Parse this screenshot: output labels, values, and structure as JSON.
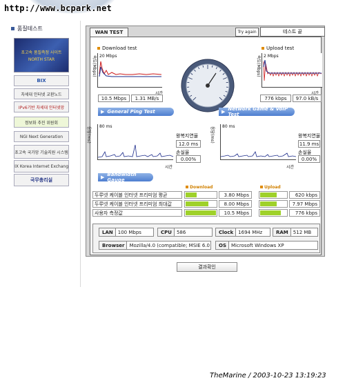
{
  "watermark": "http://www.bcpark.net",
  "sidebar": {
    "title": "품질테스트",
    "banner": {
      "line1": "초고속 품질측정 사이트",
      "line2": "NORTH STAR"
    },
    "items": [
      {
        "label": "BIX"
      },
      {
        "label": "차세대 인터넷 교환노드"
      },
      {
        "label": "IPv6기반 차세대 인터넷망"
      },
      {
        "label": "정보화 추진 위원회"
      },
      {
        "label": "NGI Next Generation"
      },
      {
        "label": "초고속 국가망 기술지원 시스템"
      },
      {
        "label": "KIX Korea Internet Exchange"
      },
      {
        "label": "국무총리실"
      }
    ]
  },
  "panel": {
    "tab": "WAN TEST",
    "try_again": "Try again",
    "test_end": "테스트 끝"
  },
  "download_test": {
    "title": "Download test",
    "ylabel": "속도(Mbps)",
    "ymax": "20 Mbps",
    "xlabel": "시간",
    "value_mbps": "10.5 Mbps",
    "value_mb": "1.31 MB/s"
  },
  "upload_test": {
    "title": "Upload test",
    "ylabel": "속도(Mbps)",
    "ymax": "2 Mbps",
    "xlabel": "시간",
    "value_kbps": "776 kbps",
    "value_kb": "97.0 kB/s"
  },
  "ping": {
    "section_title": "General Ping Test",
    "ylabel": "응답(ms)",
    "ymax": "80 ms",
    "xlabel": "시간",
    "latency_label": "왕복지연율",
    "latency_value": "12.0 ms",
    "loss_label": "손실율",
    "loss_value": "0.00%"
  },
  "voip": {
    "section_title": "Network Game & VoIP Test",
    "ylabel": "응답(ms)",
    "ymax": "80 ms",
    "xlabel": "시간",
    "latency_label": "왕복지연율",
    "latency_value": "11.9 ms",
    "loss_label": "손실율",
    "loss_value": "0.00%"
  },
  "bandwidth": {
    "section_title": "Bandwidth Gauge",
    "download_header": "Download",
    "upload_header": "Upload",
    "rows": [
      {
        "label": "두루넷 케이블 인터넷 프리미엄 평균",
        "down": "3.80 Mbps",
        "down_fill": 0.36,
        "up": "620 kbps",
        "up_fill": 0.62
      },
      {
        "label": "두루넷 케이블 인터넷 프리미엄 최대값",
        "down": "8.00 Mbps",
        "down_fill": 0.76,
        "up": "7.97 Mbps",
        "up_fill": 0.62
      },
      {
        "label": "사용자 측정값",
        "down": "10.5 Mbps",
        "down_fill": 1.0,
        "up": "776 kbps",
        "up_fill": 0.78
      }
    ]
  },
  "system": {
    "lan_label": "LAN",
    "lan_value": "100 Mbps",
    "cpu_label": "CPU",
    "cpu_value": "586",
    "clock_label": "Clock",
    "clock_value": "1694 MHz",
    "ram_label": "RAM",
    "ram_value": "512 MB",
    "browser_label": "Browser",
    "browser_value": "Mozilla/4.0 (compatible; MSIE 6.0",
    "os_label": "OS",
    "os_value": "Microsoft Windows XP"
  },
  "result_button": "결과확인",
  "caption": "TheMarine / 2003-10-23 13:19:23",
  "colors": {
    "accent_bar": "#4d7ed0",
    "gauge_fill": "#9fd12a",
    "download_line": "#cc1b1b",
    "reference_line": "#1a2a8a",
    "legend_orange": "#e08c00"
  }
}
